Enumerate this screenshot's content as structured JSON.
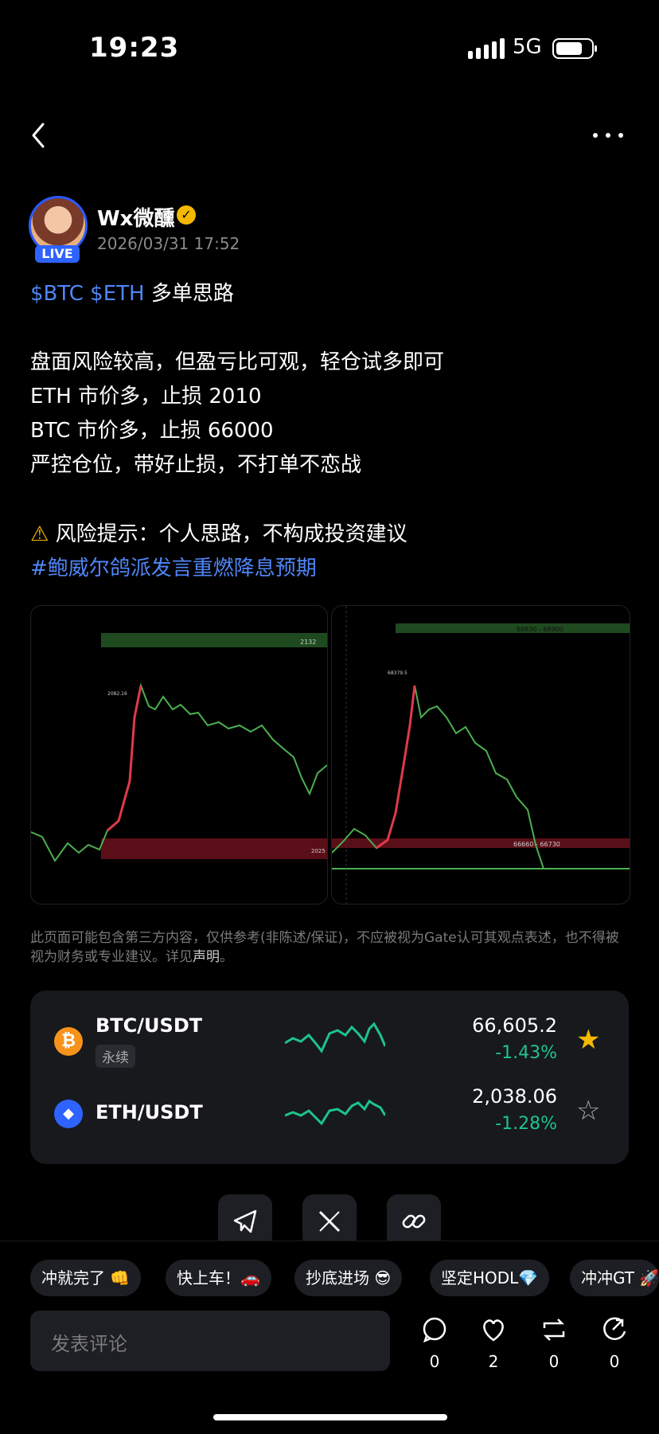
{
  "status": {
    "time": "19:23",
    "network": "5G"
  },
  "author": {
    "name": "Wx微醺",
    "live_badge": "LIVE",
    "date": "2026/03/31 17:52"
  },
  "post": {
    "tags": "$BTC $ETH",
    "title_rest": " 多单思路",
    "line1": "盘面风险较高，但盈亏比可观，轻仓试多即可",
    "line2": "ETH 市价多，止损 2010",
    "line3": "BTC 市价多，止损 66000",
    "line4": "严控仓位，带好止损，不打单不恋战",
    "risk": "风险提示：个人思路，不构成投资建议",
    "hashtag": "#鲍威尔鸽派发言重燃降息预期"
  },
  "images": {
    "left_top_label": "2132",
    "left_peak_label": "2082.16",
    "left_zone_label": "2025",
    "right_top_label": "68830 - 68900",
    "right_peak_label": "68379.5",
    "right_zone_label": "66660 - 66730"
  },
  "disclaimer": {
    "text": "此页面可能包含第三方内容，仅供参考(非陈述/保证)，不应被视为Gate认可其观点表述，也不得被视为财务或专业建议。详见",
    "link": "声明",
    "end": "。"
  },
  "markets": [
    {
      "pair": "BTC/USDT",
      "tag": "永续",
      "price": "66,605.2",
      "change": "-1.43%",
      "starred": true,
      "icon": "bitcoin-icon"
    },
    {
      "pair": "ETH/USDT",
      "tag": "",
      "price": "2,038.06",
      "change": "-1.28%",
      "starred": false,
      "icon": "ethereum-icon"
    }
  ],
  "colors": {
    "accent": "#4f86f7",
    "up": "#1cc58a",
    "star": "#f5b800"
  },
  "chips": [
    "冲就完了 👊",
    "快上车！🚗",
    "抄底进场 😎",
    "坚定HODL💎",
    "冲冲GT 🚀"
  ],
  "comment_placeholder": "发表评论",
  "actions": {
    "comments": "0",
    "likes": "2",
    "reposts": "0",
    "shares": "0"
  }
}
